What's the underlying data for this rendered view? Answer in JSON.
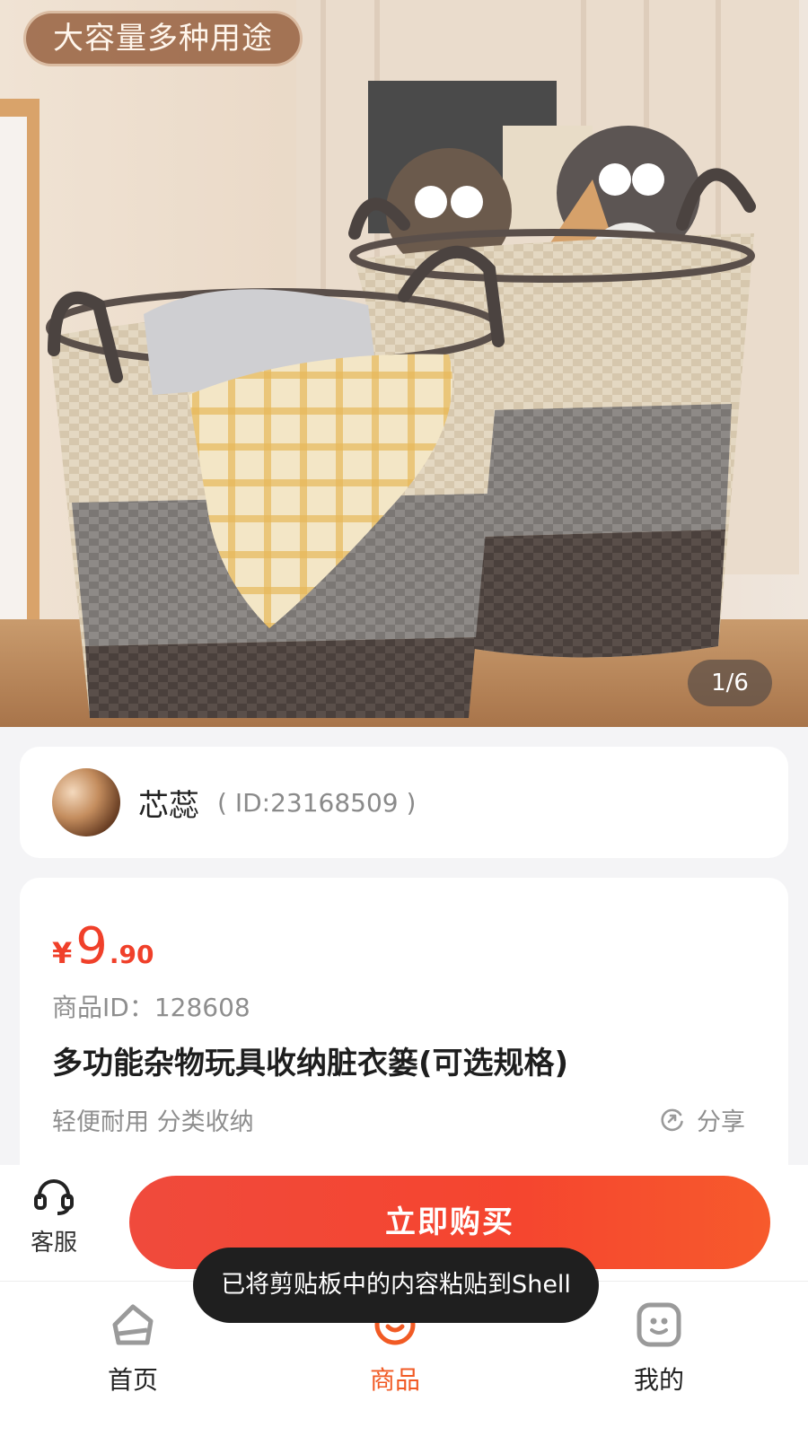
{
  "hero": {
    "tag": "大容量多种用途",
    "counter": "1/6"
  },
  "seller": {
    "name": "芯蕊",
    "id_text": "( ID:23168509 )"
  },
  "product": {
    "price_symbol": "¥",
    "price_integer": "9",
    "price_decimal": ".90",
    "id_text": "商品ID：128608",
    "title": "多功能杂物玩具收纳脏衣篓(可选规格)",
    "tags": "轻便耐用 分类收纳",
    "share_label": "分享"
  },
  "action_bar": {
    "service_label": "客服",
    "buy_label": "立即购买"
  },
  "tab_bar": {
    "items": [
      {
        "label": "首页",
        "icon": "home-icon",
        "active": false
      },
      {
        "label": "商品",
        "icon": "goods-icon",
        "active": true
      },
      {
        "label": "我的",
        "icon": "profile-icon",
        "active": false
      }
    ]
  },
  "toast": {
    "text": "已将剪贴板中的内容粘贴到Shell"
  },
  "colors": {
    "accent": "#f04a3c",
    "price": "#f0402a",
    "active_tab": "#f15a24"
  }
}
